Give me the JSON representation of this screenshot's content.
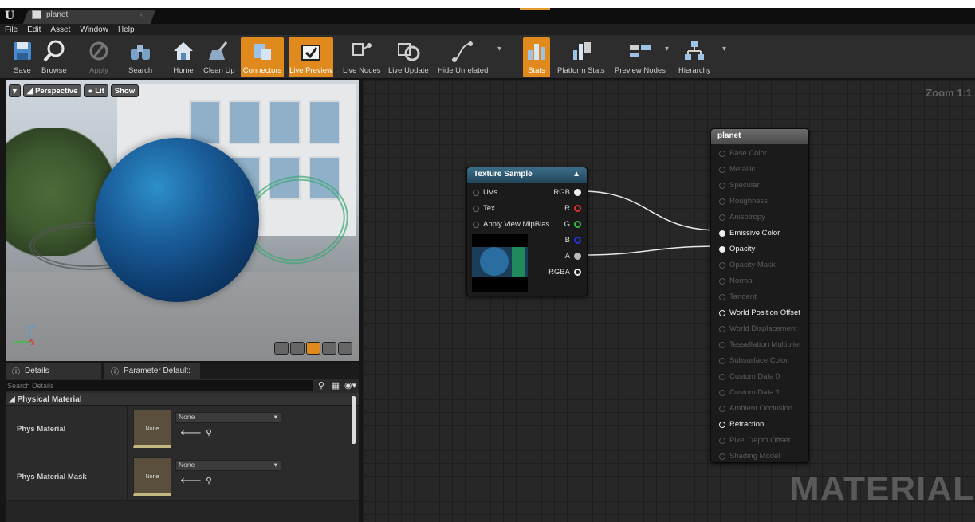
{
  "titlebar": {
    "logo": "U",
    "tab_title": "planet",
    "close": "×"
  },
  "menu": [
    "File",
    "Edit",
    "Asset",
    "Window",
    "Help"
  ],
  "toolbar": {
    "save": "Save",
    "browse": "Browse",
    "apply": "Apply",
    "search": "Search",
    "home": "Home",
    "cleanup": "Clean Up",
    "connectors": "Connectors",
    "live_preview": "Live Preview",
    "live_nodes": "Live Nodes",
    "live_update": "Live Update",
    "hide_unrelated": "Hide Unrelated",
    "stats": "Stats",
    "platform_stats": "Platform Stats",
    "preview_nodes": "Preview Nodes",
    "hierarchy": "Hierarchy"
  },
  "viewport": {
    "perspective": "Perspective",
    "lit": "Lit",
    "show": "Show",
    "axis_x": "x",
    "axis_z": "z"
  },
  "details": {
    "tab_details": "Details",
    "tab_params": "Parameter Default:",
    "search_placeholder": "Search Details",
    "category": "Physical Material",
    "props": [
      {
        "name": "Phys Material",
        "thumb": "None",
        "value": "None"
      },
      {
        "name": "Phys Material Mask",
        "thumb": "None",
        "value": "None"
      }
    ]
  },
  "graph": {
    "zoom": "Zoom 1:1",
    "watermark": "MATERIAL",
    "texture_node": {
      "title": "Texture Sample",
      "inputs": [
        "UVs",
        "Tex",
        "Apply View MipBias"
      ],
      "outputs": [
        "RGB",
        "R",
        "G",
        "B",
        "A",
        "RGBA"
      ]
    },
    "output_node": {
      "title": "planet",
      "inputs": [
        "Base Color",
        "Metallic",
        "Specular",
        "Roughness",
        "Anisotropy",
        "Emissive Color",
        "Opacity",
        "Opacity Mask",
        "Normal",
        "Tangent",
        "World Position Offset",
        "World Displacement",
        "Tessellation Multiplier",
        "Subsurface Color",
        "Custom Data 0",
        "Custom Data 1",
        "Ambient Occlusion",
        "Refraction",
        "Pixel Depth Offset",
        "Shading Model"
      ],
      "active_inputs": [
        "Emissive Color",
        "Opacity",
        "World Position Offset",
        "Refraction"
      ],
      "connected_inputs": [
        "Emissive Color",
        "Opacity"
      ]
    }
  },
  "colors": {
    "accent": "#e08a1e",
    "node_header": "#24485d",
    "pin_r": "#e53030",
    "pin_g": "#2fbf3a",
    "pin_b": "#2333d8"
  }
}
